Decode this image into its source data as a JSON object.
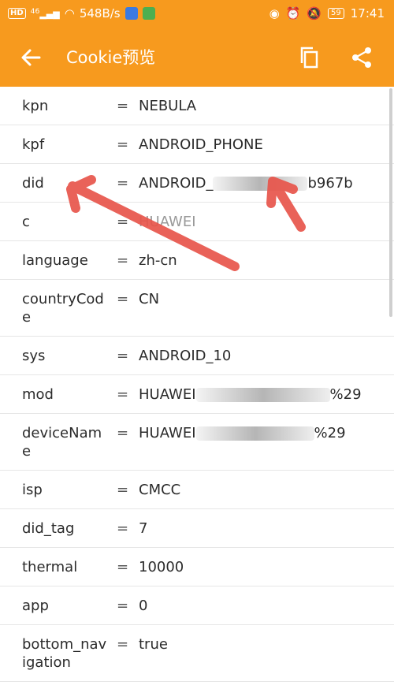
{
  "status_bar": {
    "hd": "HD",
    "net": "46",
    "speed": "548B/s",
    "battery": "59",
    "time": "17:41"
  },
  "app_bar": {
    "title": "Cookie预览",
    "back_icon": "back-arrow-icon",
    "copy_icon": "copy-icon",
    "share_icon": "share-icon"
  },
  "cookies": [
    {
      "key": "kpn",
      "eq": "=",
      "value": "NEBULA"
    },
    {
      "key": "kpf",
      "eq": "=",
      "value": "ANDROID_PHONE"
    },
    {
      "key": "did",
      "eq": "=",
      "value_start": "ANDROID_",
      "value_end": "b967b"
    },
    {
      "key": "c",
      "eq": "=",
      "value_start": "HUAWEI",
      "value_end": ""
    },
    {
      "key": "language",
      "eq": "=",
      "value": "zh-cn"
    },
    {
      "key": "countryCode",
      "eq": "=",
      "value": "CN"
    },
    {
      "key": "sys",
      "eq": "=",
      "value": "ANDROID_10"
    },
    {
      "key": "mod",
      "eq": "=",
      "value_start": "HUAWEI",
      "value_end": "%29"
    },
    {
      "key": "deviceName",
      "eq": "=",
      "value_start": "HUAWEI",
      "value_end": "%29"
    },
    {
      "key": "isp",
      "eq": "=",
      "value": "CMCC"
    },
    {
      "key": "did_tag",
      "eq": "=",
      "value": "7"
    },
    {
      "key": "thermal",
      "eq": "=",
      "value": "10000"
    },
    {
      "key": "app",
      "eq": "=",
      "value": "0"
    },
    {
      "key": "bottom_navigation",
      "eq": "=",
      "value": "true"
    }
  ],
  "colors": {
    "accent": "#f79a1e",
    "annotation_arrow": "#e8554b"
  }
}
